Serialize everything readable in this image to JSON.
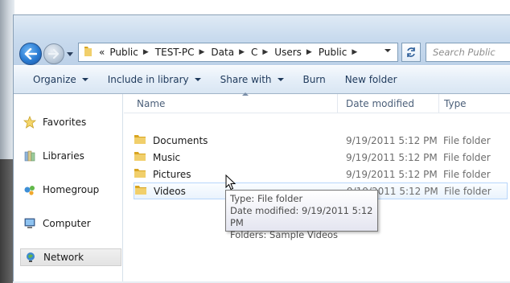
{
  "address": {
    "overflow": "«",
    "crumbs": [
      "Public",
      "TEST-PC",
      "Data",
      "C",
      "Users",
      "Public"
    ]
  },
  "search": {
    "placeholder": "Search Public"
  },
  "command_bar": {
    "organize": "Organize",
    "include_in_library": "Include in library",
    "share_with": "Share with",
    "burn": "Burn",
    "new_folder": "New folder"
  },
  "nav_pane": {
    "favorites": "Favorites",
    "libraries": "Libraries",
    "homegroup": "Homegroup",
    "computer": "Computer",
    "network": "Network"
  },
  "columns": {
    "name": "Name",
    "date_modified": "Date modified",
    "type": "Type"
  },
  "files": [
    {
      "name": "Documents",
      "date": "9/19/2011 5:12 PM",
      "type": "File folder"
    },
    {
      "name": "Music",
      "date": "9/19/2011 5:12 PM",
      "type": "File folder"
    },
    {
      "name": "Pictures",
      "date": "9/19/2011 5:12 PM",
      "type": "File folder"
    },
    {
      "name": "Videos",
      "date": "9/19/2011 5:12 PM",
      "type": "File folder"
    }
  ],
  "tooltip": {
    "line1": "Type: File folder",
    "line2": "Date modified: 9/19/2011 5:12 PM",
    "line3": "Folders: Sample Videos"
  },
  "colors": {
    "accent": "#1e395b",
    "folder": "#e8c15a",
    "hover_border": "#b8d6fb"
  }
}
